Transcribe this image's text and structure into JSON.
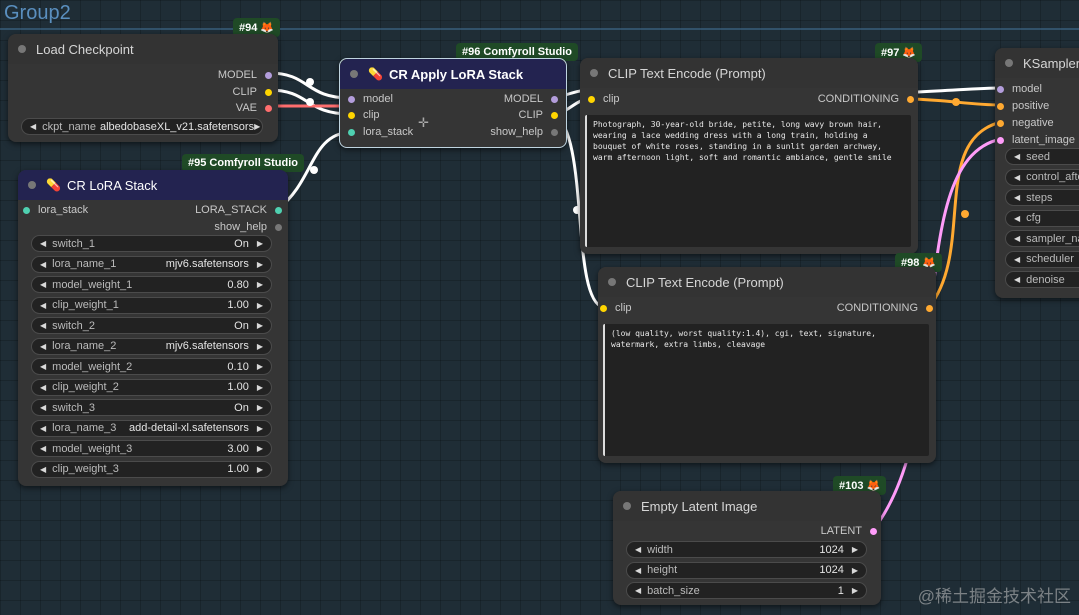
{
  "group": {
    "title": "Group2"
  },
  "colors": {
    "model": "#b39ddb",
    "clip": "#ffd500",
    "vae": "#ff6e6e",
    "lora_stack": "#4fd0b0",
    "conditioning": "#ffa931",
    "latent": "#ff9cf9",
    "badge": "#1f4a26",
    "header_blue": "#232350"
  },
  "load_checkpoint": {
    "badge": "#94 🦊",
    "title": "Load Checkpoint",
    "outputs": [
      "MODEL",
      "CLIP",
      "VAE"
    ],
    "widget": {
      "label": "ckpt_name",
      "value": "albedobaseXL_v21.safetensors"
    }
  },
  "cr_lora_stack": {
    "badge": "#95 Comfyroll Studio",
    "title": "CR LoRA Stack",
    "icon": "pill-icon",
    "input": "lora_stack",
    "outputs": [
      "LORA_STACK",
      "show_help"
    ],
    "widgets": [
      {
        "label": "switch_1",
        "value": "On"
      },
      {
        "label": "lora_name_1",
        "value": "mjv6.safetensors"
      },
      {
        "label": "model_weight_1",
        "value": "0.80"
      },
      {
        "label": "clip_weight_1",
        "value": "1.00"
      },
      {
        "label": "switch_2",
        "value": "On"
      },
      {
        "label": "lora_name_2",
        "value": "mjv6.safetensors"
      },
      {
        "label": "model_weight_2",
        "value": "0.10"
      },
      {
        "label": "clip_weight_2",
        "value": "1.00"
      },
      {
        "label": "switch_3",
        "value": "On"
      },
      {
        "label": "lora_name_3",
        "value": "add-detail-xl.safetensors"
      },
      {
        "label": "model_weight_3",
        "value": "3.00"
      },
      {
        "label": "clip_weight_3",
        "value": "1.00"
      }
    ]
  },
  "cr_apply": {
    "badge": "#96 Comfyroll Studio",
    "title": "CR Apply LoRA Stack",
    "icon": "pill-icon",
    "inputs": [
      "model",
      "clip",
      "lora_stack"
    ],
    "outputs": [
      "MODEL",
      "CLIP",
      "show_help"
    ]
  },
  "clip_pos": {
    "badge": "#97 🦊",
    "title": "CLIP Text Encode (Prompt)",
    "input": "clip",
    "output": "CONDITIONING",
    "text": "Photograph, 30-year-old bride, petite, long wavy brown hair, wearing a lace wedding dress with a long train, holding a bouquet of white roses, standing in a sunlit garden archway, warm afternoon light, soft and romantic ambiance, gentle smile"
  },
  "clip_neg": {
    "badge": "#98 🦊",
    "title": "CLIP Text Encode (Prompt)",
    "input": "clip",
    "output": "CONDITIONING",
    "text": "(low quality, worst quality:1.4), cgi,  text, signature, watermark, extra limbs, cleavage"
  },
  "ksampler": {
    "title": "KSampler",
    "inputs": [
      "model",
      "positive",
      "negative",
      "latent_image"
    ],
    "widgets": [
      "seed",
      "control_after",
      "steps",
      "cfg",
      "sampler_nam",
      "scheduler",
      "denoise"
    ]
  },
  "empty_latent": {
    "badge": "#103 🦊",
    "title": "Empty Latent Image",
    "output": "LATENT",
    "widgets": [
      {
        "label": "width",
        "value": "1024"
      },
      {
        "label": "height",
        "value": "1024"
      },
      {
        "label": "batch_size",
        "value": "1"
      }
    ]
  },
  "watermark": "@稀土掘金技术社区"
}
